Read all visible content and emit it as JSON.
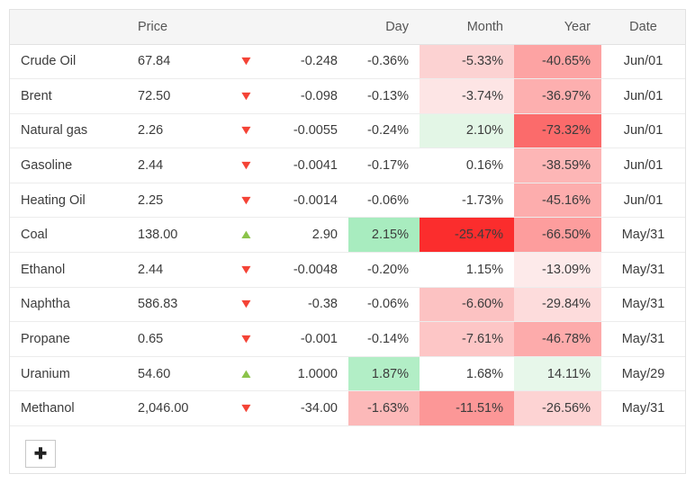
{
  "table": {
    "headers": {
      "name": "",
      "price": "Price",
      "arrow": "",
      "change": "",
      "day": "Day",
      "month": "Month",
      "year": "Year",
      "date": "Date"
    },
    "rows": [
      {
        "name": "Crude Oil",
        "price": "67.84",
        "direction": "down",
        "arrow_glyph": "▼",
        "change": "-0.248",
        "day": "-0.36%",
        "month": "-5.33%",
        "year": "-40.65%",
        "date": "Jun/01",
        "day_bg": "transparent",
        "month_bg": "#fcd2d2",
        "year_bg": "#fda3a3"
      },
      {
        "name": "Brent",
        "price": "72.50",
        "direction": "down",
        "arrow_glyph": "▼",
        "change": "-0.098",
        "day": "-0.13%",
        "month": "-3.74%",
        "year": "-36.97%",
        "date": "Jun/01",
        "day_bg": "transparent",
        "month_bg": "#fde5e5",
        "year_bg": "#fdafaf"
      },
      {
        "name": "Natural gas",
        "price": "2.26",
        "direction": "down",
        "arrow_glyph": "▼",
        "change": "-0.0055",
        "day": "-0.24%",
        "month": "2.10%",
        "year": "-73.32%",
        "date": "Jun/01",
        "day_bg": "transparent",
        "month_bg": "#e3f6e6",
        "year_bg": "#fb6b6b"
      },
      {
        "name": "Gasoline",
        "price": "2.44",
        "direction": "down",
        "arrow_glyph": "▼",
        "change": "-0.0041",
        "day": "-0.17%",
        "month": "0.16%",
        "year": "-38.59%",
        "date": "Jun/01",
        "day_bg": "transparent",
        "month_bg": "transparent",
        "year_bg": "#fdb6b6"
      },
      {
        "name": "Heating Oil",
        "price": "2.25",
        "direction": "down",
        "arrow_glyph": "▼",
        "change": "-0.0014",
        "day": "-0.06%",
        "month": "-1.73%",
        "year": "-45.16%",
        "date": "Jun/01",
        "day_bg": "transparent",
        "month_bg": "transparent",
        "year_bg": "#fdadad"
      },
      {
        "name": "Coal",
        "price": "138.00",
        "direction": "up",
        "arrow_glyph": "▲",
        "change": "2.90",
        "day": "2.15%",
        "month": "-25.47%",
        "year": "-66.50%",
        "date": "May/31",
        "day_bg": "#a8ecbf",
        "month_bg": "#fb2d2d",
        "year_bg": "#fd9d9d"
      },
      {
        "name": "Ethanol",
        "price": "2.44",
        "direction": "down",
        "arrow_glyph": "▼",
        "change": "-0.0048",
        "day": "-0.20%",
        "month": "1.15%",
        "year": "-13.09%",
        "date": "May/31",
        "day_bg": "transparent",
        "month_bg": "transparent",
        "year_bg": "#fdeaea"
      },
      {
        "name": "Naphtha",
        "price": "586.83",
        "direction": "down",
        "arrow_glyph": "▼",
        "change": "-0.38",
        "day": "-0.06%",
        "month": "-6.60%",
        "year": "-29.84%",
        "date": "May/31",
        "day_bg": "transparent",
        "month_bg": "#fcc2c2",
        "year_bg": "#fddcdc"
      },
      {
        "name": "Propane",
        "price": "0.65",
        "direction": "down",
        "arrow_glyph": "▼",
        "change": "-0.001",
        "day": "-0.14%",
        "month": "-7.61%",
        "year": "-46.78%",
        "date": "May/31",
        "day_bg": "transparent",
        "month_bg": "#fdc6c6",
        "year_bg": "#fdabab"
      },
      {
        "name": "Uranium",
        "price": "54.60",
        "direction": "up",
        "arrow_glyph": "▲",
        "change": "1.0000",
        "day": "1.87%",
        "month": "1.68%",
        "year": "14.11%",
        "date": "May/29",
        "day_bg": "#b2eec6",
        "month_bg": "transparent",
        "year_bg": "#e7f7ea"
      },
      {
        "name": "Methanol",
        "price": "2,046.00",
        "direction": "down",
        "arrow_glyph": "▼",
        "change": "-34.00",
        "day": "-1.63%",
        "month": "-11.51%",
        "year": "-26.56%",
        "date": "May/31",
        "day_bg": "#fcb9b9",
        "month_bg": "#fc9797",
        "year_bg": "#fdd3d3"
      }
    ]
  },
  "footer": {
    "add_label": "✚"
  },
  "colors": {
    "arrow_down": "#f44336",
    "arrow_up": "#8bc34a",
    "header_bg": "#f5f5f5",
    "border": "#e2e2e2"
  }
}
